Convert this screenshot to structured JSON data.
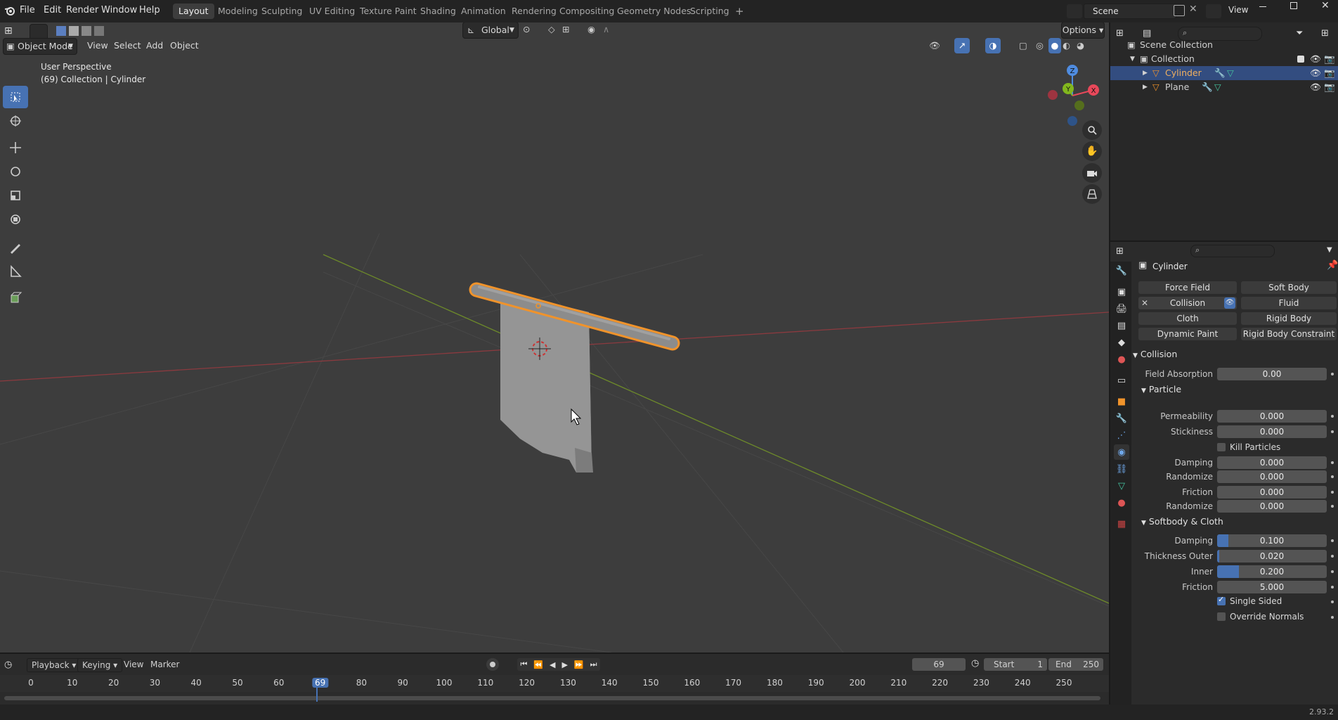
{
  "menu": [
    "File",
    "Edit",
    "Render",
    "Window",
    "Help"
  ],
  "workspaces": [
    {
      "label": "Layout",
      "active": true
    },
    {
      "label": "Modeling",
      "active": false
    },
    {
      "label": "Sculpting",
      "active": false
    },
    {
      "label": "UV Editing",
      "active": false
    },
    {
      "label": "Texture Paint",
      "active": false
    },
    {
      "label": "Shading",
      "active": false
    },
    {
      "label": "Animation",
      "active": false
    },
    {
      "label": "Rendering",
      "active": false
    },
    {
      "label": "Compositing",
      "active": false
    },
    {
      "label": "Geometry Nodes",
      "active": false
    },
    {
      "label": "Scripting",
      "active": false
    }
  ],
  "add_workspace": "+",
  "scene": {
    "name": "Scene",
    "view_layer": "View"
  },
  "viewport": {
    "mode": "Object Mode",
    "menus": [
      "View",
      "Select",
      "Add",
      "Object"
    ],
    "transform_orientation": "Global",
    "options_label": "Options",
    "overlay_line1": "User Perspective",
    "overlay_line2": "(69) Collection | Cylinder",
    "gizmo": {
      "z": "Z",
      "y": "Y",
      "x": "X"
    }
  },
  "outliner": {
    "root": "Scene Collection",
    "collection": "Collection",
    "objects": [
      {
        "name": "Cylinder",
        "selected": true
      },
      {
        "name": "Plane",
        "selected": false
      }
    ]
  },
  "properties": {
    "object_name": "Cylinder",
    "physics_buttons": [
      [
        "Force Field",
        "Soft Body"
      ],
      [
        "Collision",
        "Fluid"
      ],
      [
        "Cloth",
        "Rigid Body"
      ],
      [
        "Dynamic Paint",
        "Rigid Body Constraint"
      ]
    ],
    "collision_header": "Collision",
    "field_absorption": {
      "label": "Field Absorption",
      "value": "0.00"
    },
    "particle_header": "Particle",
    "particle": {
      "permeability": {
        "label": "Permeability",
        "value": "0.000"
      },
      "stickiness": {
        "label": "Stickiness",
        "value": "0.000"
      },
      "kill_particles": "Kill Particles",
      "damping": {
        "label": "Damping",
        "value": "0.000"
      },
      "damping_randomize": {
        "label": "Randomize",
        "value": "0.000"
      },
      "friction": {
        "label": "Friction",
        "value": "0.000"
      },
      "friction_randomize": {
        "label": "Randomize",
        "value": "0.000"
      }
    },
    "softbody_header": "Softbody & Cloth",
    "softbody": {
      "damping": {
        "label": "Damping",
        "value": "0.100",
        "fill": 0.1
      },
      "thickness_outer": {
        "label": "Thickness Outer",
        "value": "0.020",
        "fill": 0.02
      },
      "inner": {
        "label": "Inner",
        "value": "0.200",
        "fill": 0.2
      },
      "friction": {
        "label": "Friction",
        "value": "5.000",
        "fill": 0.0
      },
      "single_sided": {
        "label": "Single Sided",
        "checked": true
      },
      "override_normals": {
        "label": "Override Normals",
        "checked": false
      }
    }
  },
  "timeline": {
    "menus": [
      "Playback",
      "Keying",
      "View",
      "Marker"
    ],
    "current_frame": "69",
    "start_label": "Start",
    "start": "1",
    "end_label": "End",
    "end": "250",
    "ticks": [
      "0",
      "10",
      "20",
      "30",
      "40",
      "50",
      "60",
      "69",
      "80",
      "90",
      "100",
      "110",
      "120",
      "130",
      "140",
      "150",
      "160",
      "170",
      "180",
      "190",
      "200",
      "210",
      "220",
      "230",
      "240",
      "250"
    ]
  },
  "status": {
    "version": "2.93.2"
  },
  "colors": {
    "accent": "#4772b3",
    "selection": "#f0932b",
    "x_axis": "#e8485a",
    "y_axis": "#82b71e",
    "z_axis": "#4f8ce0"
  }
}
